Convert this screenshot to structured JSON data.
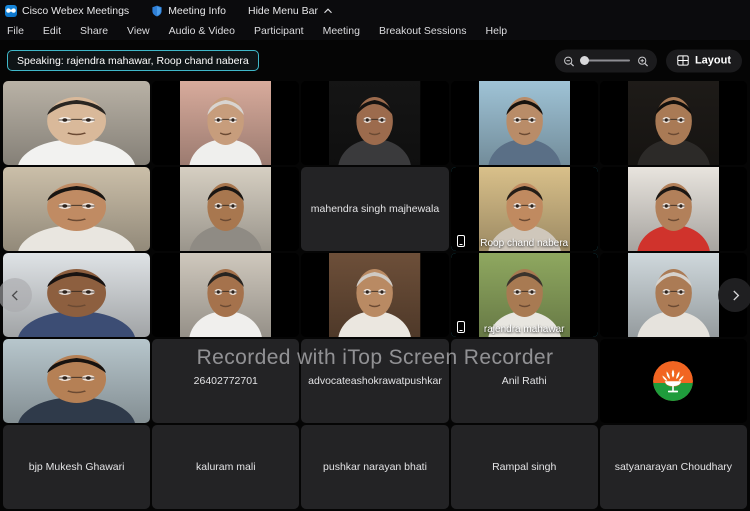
{
  "titlebar": {
    "app_icon": "webex-logo-icon",
    "app_title": "Cisco Webex Meetings",
    "meeting_info_icon": "shield-icon",
    "meeting_info_label": "Meeting Info",
    "hide_menu_label": "Hide Menu Bar",
    "hide_menu_icon": "chevron-up-icon"
  },
  "menubar": {
    "items": [
      {
        "label": "File"
      },
      {
        "label": "Edit"
      },
      {
        "label": "Share"
      },
      {
        "label": "View"
      },
      {
        "label": "Audio & Video"
      },
      {
        "label": "Participant"
      },
      {
        "label": "Meeting"
      },
      {
        "label": "Breakout Sessions"
      },
      {
        "label": "Help"
      }
    ]
  },
  "toolbar": {
    "speaking_label": "Speaking: rajendra mahawar, Roop chand nabera",
    "zoom_out_icon": "zoom-out-icon",
    "zoom_in_icon": "zoom-in-icon",
    "zoom_value": 0,
    "layout_label": "Layout",
    "layout_icon": "grid-icon"
  },
  "grid": {
    "prev_label": "chevron-left-icon",
    "next_label": "chevron-right-icon",
    "watermark": "Recorded with iTop Screen Recorder",
    "tiles": [
      {
        "name": "",
        "kind": "video",
        "active": false,
        "skin": "#d9b99a",
        "bg": "#b9b2a6",
        "shirt": "#f2f2f0",
        "hair": "#2a2622",
        "wide": true
      },
      {
        "name": "",
        "kind": "video",
        "active": false,
        "skin": "#c79d7c",
        "bg": "#d8ab9c",
        "shirt": "#efefed",
        "hair": "#d8d4d0",
        "wide": false
      },
      {
        "name": "",
        "kind": "video",
        "active": false,
        "skin": "#9c6b4d",
        "bg": "#151515",
        "shirt": "#3a3a3c",
        "hair": "#151210",
        "wide": false
      },
      {
        "name": "",
        "kind": "video",
        "active": false,
        "skin": "#b98c68",
        "bg": "#9fc3d6",
        "shirt": "#5a6f86",
        "hair": "#17120e",
        "wide": false
      },
      {
        "name": "",
        "kind": "video",
        "active": false,
        "skin": "#a97a55",
        "bg": "#1e1b18",
        "shirt": "#2c2a28",
        "hair": "#120f0c",
        "wide": false
      },
      {
        "name": "",
        "kind": "video",
        "active": false,
        "skin": "#c08b63",
        "bg": "#cbbfa9",
        "shirt": "#e9e6e0",
        "hair": "#191512",
        "wide": true
      },
      {
        "name": "",
        "kind": "video",
        "active": false,
        "skin": "#a8774f",
        "bg": "#d6cfc2",
        "shirt": "#8f8b84",
        "hair": "#1a1613",
        "wide": false
      },
      {
        "name": "mahendra singh majhewala",
        "kind": "namecard",
        "active": false
      },
      {
        "name": "Roop chand nabera",
        "kind": "video",
        "active": true,
        "mobile": true,
        "skin": "#c08a60",
        "bg": "#d9c08a",
        "shirt": "#cfc7bb",
        "hair": "#241d17",
        "wide": false
      },
      {
        "name": "",
        "kind": "video",
        "active": false,
        "skin": "#b2805a",
        "bg": "#e8e4de",
        "shirt": "#d0332c",
        "hair": "#1c1714",
        "wide": false
      },
      {
        "name": "",
        "kind": "video",
        "active": false,
        "skin": "#8d5f3f",
        "bg": "#dfe3e6",
        "shirt": "#3c4d74",
        "hair": "#191311",
        "wide": true
      },
      {
        "name": "",
        "kind": "video",
        "active": false,
        "skin": "#a5724c",
        "bg": "#cfc8bd",
        "shirt": "#f0efed",
        "hair": "#282420",
        "wide": false
      },
      {
        "name": "",
        "kind": "video",
        "active": false,
        "skin": "#b98a63",
        "bg": "#6d4f39",
        "shirt": "#ebe7e0",
        "hair": "#cfcac4",
        "wide": false
      },
      {
        "name": "rajendra mahawar",
        "kind": "video",
        "active": true,
        "mobile": true,
        "skin": "#a87a52",
        "bg": "#8fa860",
        "shirt": "#e8e6e0",
        "hair": "#3a332c",
        "wide": false
      },
      {
        "name": "",
        "kind": "video",
        "active": false,
        "skin": "#ab7b55",
        "bg": "#cfd8dc",
        "shirt": "#e6e3dd",
        "hair": "#d6d2cd",
        "wide": false
      },
      {
        "name": "",
        "kind": "video",
        "active": false,
        "skin": "#b58055",
        "bg": "#b7c6cc",
        "shirt": "#2f3a4a",
        "hair": "#17120f",
        "wide": true
      },
      {
        "name": "26402772701",
        "kind": "namecard",
        "active": false
      },
      {
        "name": "advocateashokrawatpushkar",
        "kind": "namecard",
        "active": false
      },
      {
        "name": "Anil Rathi",
        "kind": "namecard",
        "active": false
      },
      {
        "name": "",
        "kind": "logo",
        "active": false
      },
      {
        "name": "bjp Mukesh Ghawari",
        "kind": "namecard",
        "active": false
      },
      {
        "name": "kaluram mali",
        "kind": "namecard",
        "active": false
      },
      {
        "name": "pushkar narayan bhati",
        "kind": "namecard",
        "active": false
      },
      {
        "name": "Rampal singh",
        "kind": "namecard",
        "active": false
      },
      {
        "name": "satyanarayan Choudhary",
        "kind": "namecard",
        "active": false
      }
    ]
  },
  "colors": {
    "accent": "#34c3de",
    "speaking_border": "#3fb8c9",
    "namecard_bg": "#232325",
    "chrome_bg": "#0b0b0d",
    "bjp_orange": "#f26522",
    "bjp_green": "#1f9c3c"
  }
}
